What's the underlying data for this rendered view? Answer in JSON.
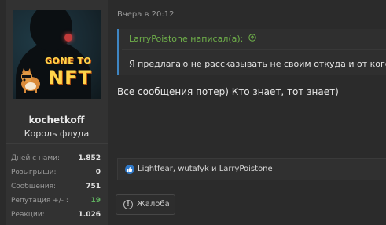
{
  "user": {
    "name": "kochetkoff",
    "title": "Король флуда",
    "avatar_text": {
      "line1": "GONE TO",
      "line2": "NFT"
    },
    "stats": [
      {
        "label": "Дней с нами:",
        "value": "1.852"
      },
      {
        "label": "Розыгрыши:",
        "value": "0"
      },
      {
        "label": "Сообщения:",
        "value": "751"
      },
      {
        "label": "Репутация +/- :",
        "value": "19"
      },
      {
        "label": "Реакции:",
        "value": "1.026"
      }
    ]
  },
  "post": {
    "date": "Вчера в 20:12",
    "quote": {
      "author_line": "LarryPoistone написал(а):",
      "text": "Я предлагаю не рассказывать не своим откуда и от кого з"
    },
    "message": "Все сообщения потер) Кто знает, тот знает)",
    "likes_text": "Lightfear, wutafyk и LarryPoistone",
    "report_label": "Жалоба"
  },
  "colors": {
    "accent_quote": "#3f86c3",
    "quote_author": "#6fb04a",
    "reputation_positive": "#5fb05f",
    "like_icon": "#2f79c9"
  },
  "icons": {
    "quote_jump": "up-arrow-circle-icon",
    "like": "thumbs-up-icon",
    "report": "exclamation-circle-icon"
  }
}
